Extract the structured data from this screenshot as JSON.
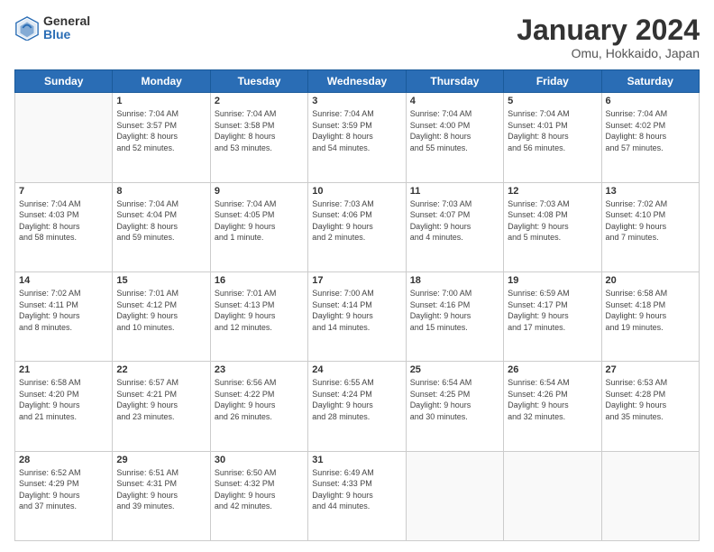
{
  "header": {
    "logo_general": "General",
    "logo_blue": "Blue",
    "month_title": "January 2024",
    "location": "Omu, Hokkaido, Japan"
  },
  "weekdays": [
    "Sunday",
    "Monday",
    "Tuesday",
    "Wednesday",
    "Thursday",
    "Friday",
    "Saturday"
  ],
  "weeks": [
    [
      {
        "day": "",
        "info": ""
      },
      {
        "day": "1",
        "info": "Sunrise: 7:04 AM\nSunset: 3:57 PM\nDaylight: 8 hours\nand 52 minutes."
      },
      {
        "day": "2",
        "info": "Sunrise: 7:04 AM\nSunset: 3:58 PM\nDaylight: 8 hours\nand 53 minutes."
      },
      {
        "day": "3",
        "info": "Sunrise: 7:04 AM\nSunset: 3:59 PM\nDaylight: 8 hours\nand 54 minutes."
      },
      {
        "day": "4",
        "info": "Sunrise: 7:04 AM\nSunset: 4:00 PM\nDaylight: 8 hours\nand 55 minutes."
      },
      {
        "day": "5",
        "info": "Sunrise: 7:04 AM\nSunset: 4:01 PM\nDaylight: 8 hours\nand 56 minutes."
      },
      {
        "day": "6",
        "info": "Sunrise: 7:04 AM\nSunset: 4:02 PM\nDaylight: 8 hours\nand 57 minutes."
      }
    ],
    [
      {
        "day": "7",
        "info": "Sunrise: 7:04 AM\nSunset: 4:03 PM\nDaylight: 8 hours\nand 58 minutes."
      },
      {
        "day": "8",
        "info": "Sunrise: 7:04 AM\nSunset: 4:04 PM\nDaylight: 8 hours\nand 59 minutes."
      },
      {
        "day": "9",
        "info": "Sunrise: 7:04 AM\nSunset: 4:05 PM\nDaylight: 9 hours\nand 1 minute."
      },
      {
        "day": "10",
        "info": "Sunrise: 7:03 AM\nSunset: 4:06 PM\nDaylight: 9 hours\nand 2 minutes."
      },
      {
        "day": "11",
        "info": "Sunrise: 7:03 AM\nSunset: 4:07 PM\nDaylight: 9 hours\nand 4 minutes."
      },
      {
        "day": "12",
        "info": "Sunrise: 7:03 AM\nSunset: 4:08 PM\nDaylight: 9 hours\nand 5 minutes."
      },
      {
        "day": "13",
        "info": "Sunrise: 7:02 AM\nSunset: 4:10 PM\nDaylight: 9 hours\nand 7 minutes."
      }
    ],
    [
      {
        "day": "14",
        "info": "Sunrise: 7:02 AM\nSunset: 4:11 PM\nDaylight: 9 hours\nand 8 minutes."
      },
      {
        "day": "15",
        "info": "Sunrise: 7:01 AM\nSunset: 4:12 PM\nDaylight: 9 hours\nand 10 minutes."
      },
      {
        "day": "16",
        "info": "Sunrise: 7:01 AM\nSunset: 4:13 PM\nDaylight: 9 hours\nand 12 minutes."
      },
      {
        "day": "17",
        "info": "Sunrise: 7:00 AM\nSunset: 4:14 PM\nDaylight: 9 hours\nand 14 minutes."
      },
      {
        "day": "18",
        "info": "Sunrise: 7:00 AM\nSunset: 4:16 PM\nDaylight: 9 hours\nand 15 minutes."
      },
      {
        "day": "19",
        "info": "Sunrise: 6:59 AM\nSunset: 4:17 PM\nDaylight: 9 hours\nand 17 minutes."
      },
      {
        "day": "20",
        "info": "Sunrise: 6:58 AM\nSunset: 4:18 PM\nDaylight: 9 hours\nand 19 minutes."
      }
    ],
    [
      {
        "day": "21",
        "info": "Sunrise: 6:58 AM\nSunset: 4:20 PM\nDaylight: 9 hours\nand 21 minutes."
      },
      {
        "day": "22",
        "info": "Sunrise: 6:57 AM\nSunset: 4:21 PM\nDaylight: 9 hours\nand 23 minutes."
      },
      {
        "day": "23",
        "info": "Sunrise: 6:56 AM\nSunset: 4:22 PM\nDaylight: 9 hours\nand 26 minutes."
      },
      {
        "day": "24",
        "info": "Sunrise: 6:55 AM\nSunset: 4:24 PM\nDaylight: 9 hours\nand 28 minutes."
      },
      {
        "day": "25",
        "info": "Sunrise: 6:54 AM\nSunset: 4:25 PM\nDaylight: 9 hours\nand 30 minutes."
      },
      {
        "day": "26",
        "info": "Sunrise: 6:54 AM\nSunset: 4:26 PM\nDaylight: 9 hours\nand 32 minutes."
      },
      {
        "day": "27",
        "info": "Sunrise: 6:53 AM\nSunset: 4:28 PM\nDaylight: 9 hours\nand 35 minutes."
      }
    ],
    [
      {
        "day": "28",
        "info": "Sunrise: 6:52 AM\nSunset: 4:29 PM\nDaylight: 9 hours\nand 37 minutes."
      },
      {
        "day": "29",
        "info": "Sunrise: 6:51 AM\nSunset: 4:31 PM\nDaylight: 9 hours\nand 39 minutes."
      },
      {
        "day": "30",
        "info": "Sunrise: 6:50 AM\nSunset: 4:32 PM\nDaylight: 9 hours\nand 42 minutes."
      },
      {
        "day": "31",
        "info": "Sunrise: 6:49 AM\nSunset: 4:33 PM\nDaylight: 9 hours\nand 44 minutes."
      },
      {
        "day": "",
        "info": ""
      },
      {
        "day": "",
        "info": ""
      },
      {
        "day": "",
        "info": ""
      }
    ]
  ]
}
